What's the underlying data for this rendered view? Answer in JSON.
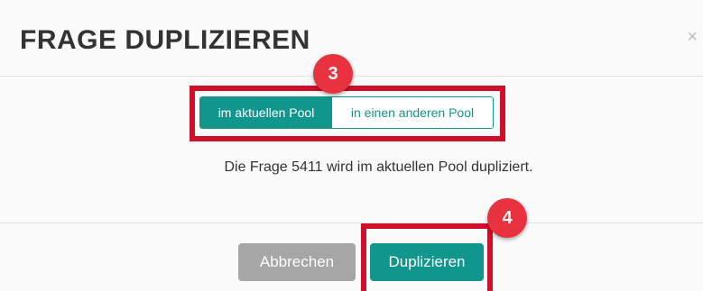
{
  "dialog": {
    "title": "FRAGE DUPLIZIEREN",
    "close_icon": "close-icon",
    "close_glyph": "×"
  },
  "segmented": {
    "options": [
      {
        "label": "im aktuellen Pool",
        "selected": true
      },
      {
        "label": "in einen anderen Pool",
        "selected": false
      }
    ],
    "accent": "#11968d"
  },
  "message": "Die Frage 5411 wird im aktuellen Pool dupliziert.",
  "footer": {
    "cancel_label": "Abbrechen",
    "duplicate_label": "Duplizieren"
  },
  "annotations": {
    "step3": "3",
    "step4": "4",
    "highlight_color": "#d0102a",
    "badge_color": "#e8323f"
  }
}
